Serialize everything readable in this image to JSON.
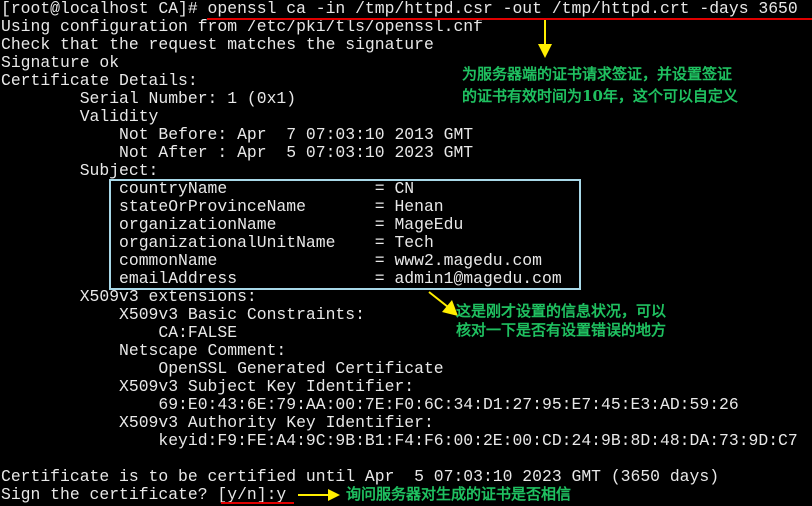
{
  "terminal": {
    "lines": [
      "[root@localhost CA]# openssl ca -in /tmp/httpd.csr -out /tmp/httpd.crt -days 3650",
      "Using configuration from /etc/pki/tls/openssl.cnf",
      "Check that the request matches the signature",
      "Signature ok",
      "Certificate Details:",
      "        Serial Number: 1 (0x1)",
      "        Validity",
      "            Not Before: Apr  7 07:03:10 2013 GMT",
      "            Not After : Apr  5 07:03:10 2023 GMT",
      "        Subject:",
      "            countryName               = CN",
      "            stateOrProvinceName       = Henan",
      "            organizationName          = MageEdu",
      "            organizationalUnitName    = Tech",
      "            commonName                = www2.magedu.com",
      "            emailAddress              = admin1@magedu.com",
      "        X509v3 extensions:",
      "            X509v3 Basic Constraints:",
      "                CA:FALSE",
      "            Netscape Comment:",
      "                OpenSSL Generated Certificate",
      "            X509v3 Subject Key Identifier:",
      "                69:E0:43:6E:79:AA:00:7E:F0:6C:34:D1:27:95:E7:45:E3:AD:59:26",
      "            X509v3 Authority Key Identifier:",
      "                keyid:F9:FE:A4:9C:9B:B1:F4:F6:00:2E:00:CD:24:9B:8D:48:DA:73:9D:C7",
      "",
      "Certificate is to be certified until Apr  5 07:03:10 2023 GMT (3650 days)",
      "Sign the certificate? [y/n]:y"
    ]
  },
  "annotations": {
    "sign_note": [
      "为服务器端的证书请求签证，并设置签证",
      "的证书有效时间为10年，这个可以自定义"
    ],
    "subject_note": [
      "这是刚才设置的信息状况，可以",
      "核对一下是否有设置错误的地方"
    ],
    "confirm_note": "询问服务器对生成的证书是否相信"
  },
  "colors": {
    "background": "#000000",
    "text": "#e8e8e8",
    "note": "#1fc060",
    "arrow": "#ffee00",
    "underline": "#e00000",
    "box": "#a8d8e8"
  }
}
